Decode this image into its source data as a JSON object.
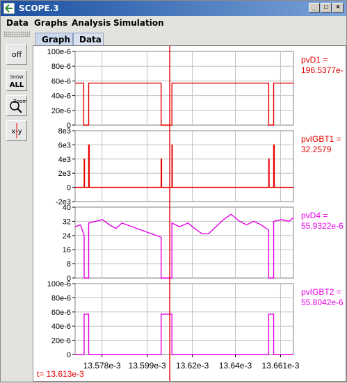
{
  "window": {
    "title": "SCOPE.3",
    "controls": [
      "_",
      "□",
      "×"
    ]
  },
  "menu": {
    "items": [
      "Data",
      "Graphs",
      "Analysis",
      "Simulation"
    ]
  },
  "toolbar": {
    "buttons": [
      {
        "label": "off",
        "icon": "power-off-icon"
      },
      {
        "label": "SHOW ALL",
        "icon": "show-all-icon"
      },
      {
        "label": "Zoom",
        "icon": "zoom-icon"
      },
      {
        "label": "x-y",
        "icon": "xy-icon"
      }
    ]
  },
  "tabs": [
    "Graph",
    "Data"
  ],
  "active_tab": "Graph",
  "cursor": {
    "readout": "t= 13.613e-3",
    "color": "#e60000"
  },
  "colors": {
    "red": "#e60000",
    "magenta": "#e600e6",
    "grid": "#c0c0c0"
  },
  "chart_data": [
    {
      "type": "line",
      "series": [
        {
          "name": "pvD1",
          "color": "#e60000",
          "x": [
            13.5655,
            13.5695,
            13.5695,
            13.5718,
            13.5718,
            13.6055,
            13.6055,
            13.6105,
            13.6105,
            13.6555,
            13.6555,
            13.6578,
            13.6578,
            13.667
          ],
          "values": [
            5.7e-05,
            5.7e-05,
            0,
            0,
            5.7e-05,
            5.7e-05,
            0,
            0,
            5.7e-05,
            5.7e-05,
            0,
            0,
            5.7e-05,
            5.7e-05
          ]
        }
      ],
      "legend": {
        "label": "pvD1 =",
        "value": "196.5377e-"
      },
      "yticks": [
        "100e-6",
        "80e-6",
        "60e-6",
        "40e-6",
        "20e-6",
        "0"
      ],
      "ylim": [
        0,
        0.0001
      ]
    },
    {
      "type": "line",
      "series": [
        {
          "name": "pvIGBT1",
          "color": "#e60000",
          "x": [
            13.5655,
            13.5697,
            13.5697,
            13.5699,
            13.5699,
            13.5718,
            13.5718,
            13.5721,
            13.5721,
            13.5723,
            13.5723,
            13.6055,
            13.6055,
            13.6057,
            13.6057,
            13.6105,
            13.6105,
            13.6107,
            13.6107,
            13.6109,
            13.6109,
            13.6555,
            13.6555,
            13.6557,
            13.6557,
            13.6578,
            13.6578,
            13.6581,
            13.6581,
            13.6583,
            13.6583,
            13.667
          ],
          "values": [
            0,
            0,
            4000,
            4000,
            0,
            0,
            6000,
            6000,
            0,
            0,
            0,
            0,
            4000,
            4000,
            0,
            0,
            6000,
            6000,
            0,
            0,
            0,
            0,
            4000,
            4000,
            0,
            0,
            6000,
            6000,
            0,
            0,
            0,
            0
          ]
        }
      ],
      "legend": {
        "label": "pvIGBT1 =",
        "value": "32.2579"
      },
      "yticks": [
        "8e3",
        "6e3",
        "4e3",
        "2e3",
        "0",
        "-2e3"
      ],
      "ylim": [
        -2000,
        8000
      ]
    },
    {
      "type": "line",
      "series": [
        {
          "name": "pvD4",
          "color": "#e600e6",
          "x": [
            13.5655,
            13.568,
            13.5697,
            13.5697,
            13.5718,
            13.5718,
            13.575,
            13.5782,
            13.5815,
            13.5845,
            13.5873,
            13.6055,
            13.6055,
            13.6105,
            13.6105,
            13.614,
            13.618,
            13.621,
            13.6245,
            13.6275,
            13.631,
            13.6345,
            13.638,
            13.642,
            13.6452,
            13.6485,
            13.652,
            13.6555,
            13.6555,
            13.6578,
            13.6578,
            13.6615,
            13.6648,
            13.667
          ],
          "values": [
            29,
            30,
            24,
            0,
            0,
            31,
            32,
            33,
            30,
            28,
            31,
            23,
            0,
            0,
            31,
            29,
            31,
            28,
            25,
            25,
            29,
            33,
            36,
            32,
            30,
            32,
            30,
            27,
            0,
            0,
            32,
            33,
            32,
            34
          ]
        }
      ],
      "legend": {
        "label": "pvD4 =",
        "value": "55.9322e-6"
      },
      "yticks": [
        "40",
        "32",
        "24",
        "16",
        "8",
        "0"
      ],
      "ylim": [
        0,
        40
      ]
    },
    {
      "type": "line",
      "series": [
        {
          "name": "pvIGBT2",
          "color": "#e600e6",
          "x": [
            13.5655,
            13.5697,
            13.5697,
            13.5718,
            13.5718,
            13.6055,
            13.6055,
            13.6105,
            13.6105,
            13.6555,
            13.6555,
            13.6578,
            13.6578,
            13.667
          ],
          "values": [
            0,
            0,
            5.7e-05,
            5.7e-05,
            0,
            0,
            5.7e-05,
            5.7e-05,
            0,
            0,
            5.7e-05,
            5.7e-05,
            0,
            0
          ]
        }
      ],
      "legend": {
        "label": "pvIGBT2 =",
        "value": "55.8042e-6"
      },
      "yticks": [
        "100e-6",
        "80e-6",
        "60e-6",
        "40e-6",
        "20e-6",
        "0"
      ],
      "ylim": [
        0,
        0.0001
      ]
    }
  ],
  "x_axis": {
    "ticks": [
      "13.578e-3",
      "13.599e-3",
      "13.62e-3",
      "13.64e-3",
      "13.661e-3"
    ],
    "tick_values": [
      13.578,
      13.599,
      13.62,
      13.64,
      13.661
    ],
    "xlim": [
      13.5655,
      13.667
    ],
    "cursor_x": 13.6095
  }
}
